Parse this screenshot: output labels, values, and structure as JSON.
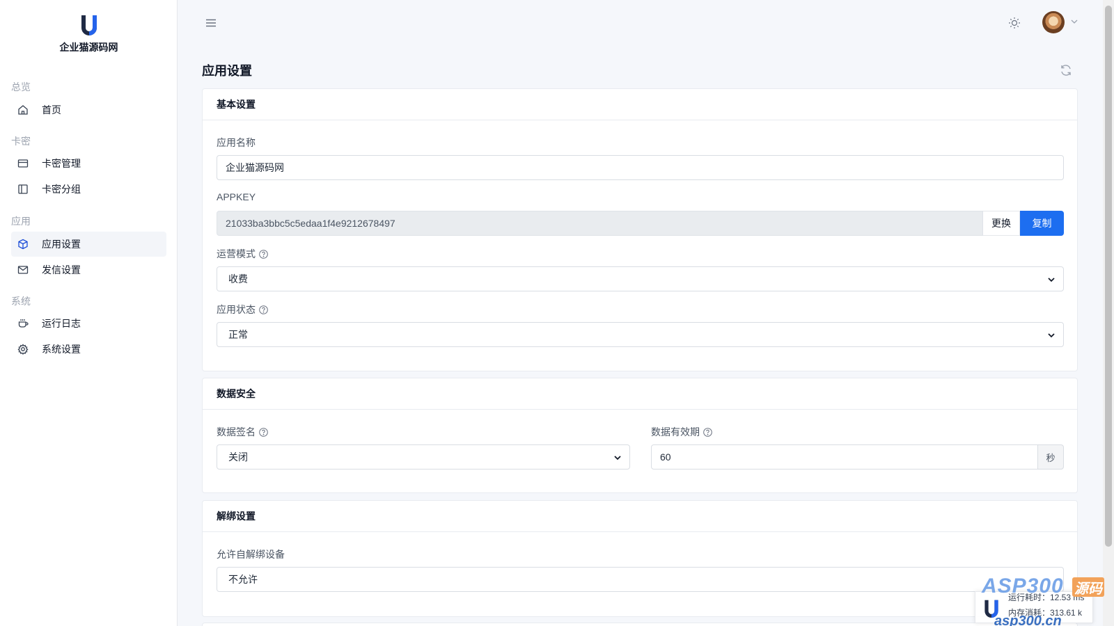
{
  "brand": {
    "name": "企业猫源码网"
  },
  "sidebar": {
    "sections": [
      {
        "title": "总览",
        "items": [
          {
            "label": "首页",
            "icon": "home-icon"
          }
        ]
      },
      {
        "title": "卡密",
        "items": [
          {
            "label": "卡密管理",
            "icon": "card-icon"
          },
          {
            "label": "卡密分组",
            "icon": "sidebar-panel-icon"
          }
        ]
      },
      {
        "title": "应用",
        "items": [
          {
            "label": "应用设置",
            "icon": "box-icon",
            "active": true
          },
          {
            "label": "发信设置",
            "icon": "mail-icon"
          }
        ]
      },
      {
        "title": "系统",
        "items": [
          {
            "label": "运行日志",
            "icon": "cup-icon"
          },
          {
            "label": "系统设置",
            "icon": "gear-icon"
          }
        ]
      }
    ]
  },
  "page": {
    "title": "应用设置"
  },
  "basic": {
    "title": "基本设置",
    "app_name_label": "应用名称",
    "app_name_value": "企业猫源码网",
    "appkey_label": "APPKEY",
    "appkey_value": "21033ba3bbc5c5edaa1f4e9212678497",
    "change_button": "更换",
    "copy_button": "复制",
    "mode_label": "运营模式",
    "mode_value": "收费",
    "status_label": "应用状态",
    "status_value": "正常"
  },
  "security": {
    "title": "数据安全",
    "sign_label": "数据签名",
    "sign_value": "关闭",
    "expiry_label": "数据有效期",
    "expiry_value": "60",
    "expiry_unit": "秒"
  },
  "unbind": {
    "title": "解绑设置",
    "self_unbind_label": "允许自解绑设备",
    "self_unbind_value": "不允许"
  },
  "watermark": {
    "brand": "ASP300",
    "brand_suffix": "源码",
    "url": "asp300.cn",
    "runtime": "运行耗时：12.53 ms",
    "memory": "内存消耗：313.61 k"
  },
  "colors": {
    "primary": "#1d6ef0",
    "active_nav_icon": "#1d4ed8",
    "sidebar_bg": "#ffffff",
    "page_bg": "#f5f7fb"
  }
}
